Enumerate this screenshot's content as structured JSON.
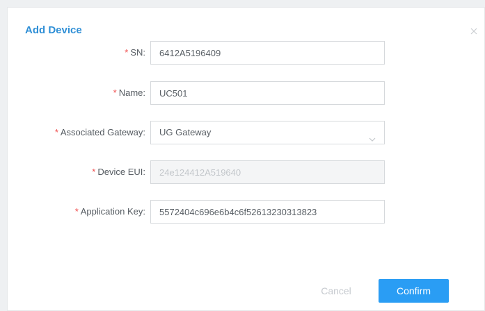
{
  "dialog": {
    "title": "Add Device"
  },
  "form": {
    "required_mark": "*",
    "sn": {
      "label": "SN:",
      "value": "6412A5196409"
    },
    "name": {
      "label": "Name:",
      "value": "UC501"
    },
    "gateway": {
      "label": "Associated Gateway:",
      "value": "UG Gateway"
    },
    "device_eui": {
      "label": "Device EUI:",
      "value": "24e124412A519640"
    },
    "app_key": {
      "label": "Application Key:",
      "value": "5572404c696e6b4c6f52613230313823"
    }
  },
  "actions": {
    "cancel_label": "Cancel",
    "confirm_label": "Confirm"
  },
  "colors": {
    "accent": "#2a9df4",
    "title": "#2f8fd6",
    "required": "#f04e4e"
  },
  "icons": {
    "close": "close-icon",
    "dropdown": "chevron-down-icon"
  }
}
